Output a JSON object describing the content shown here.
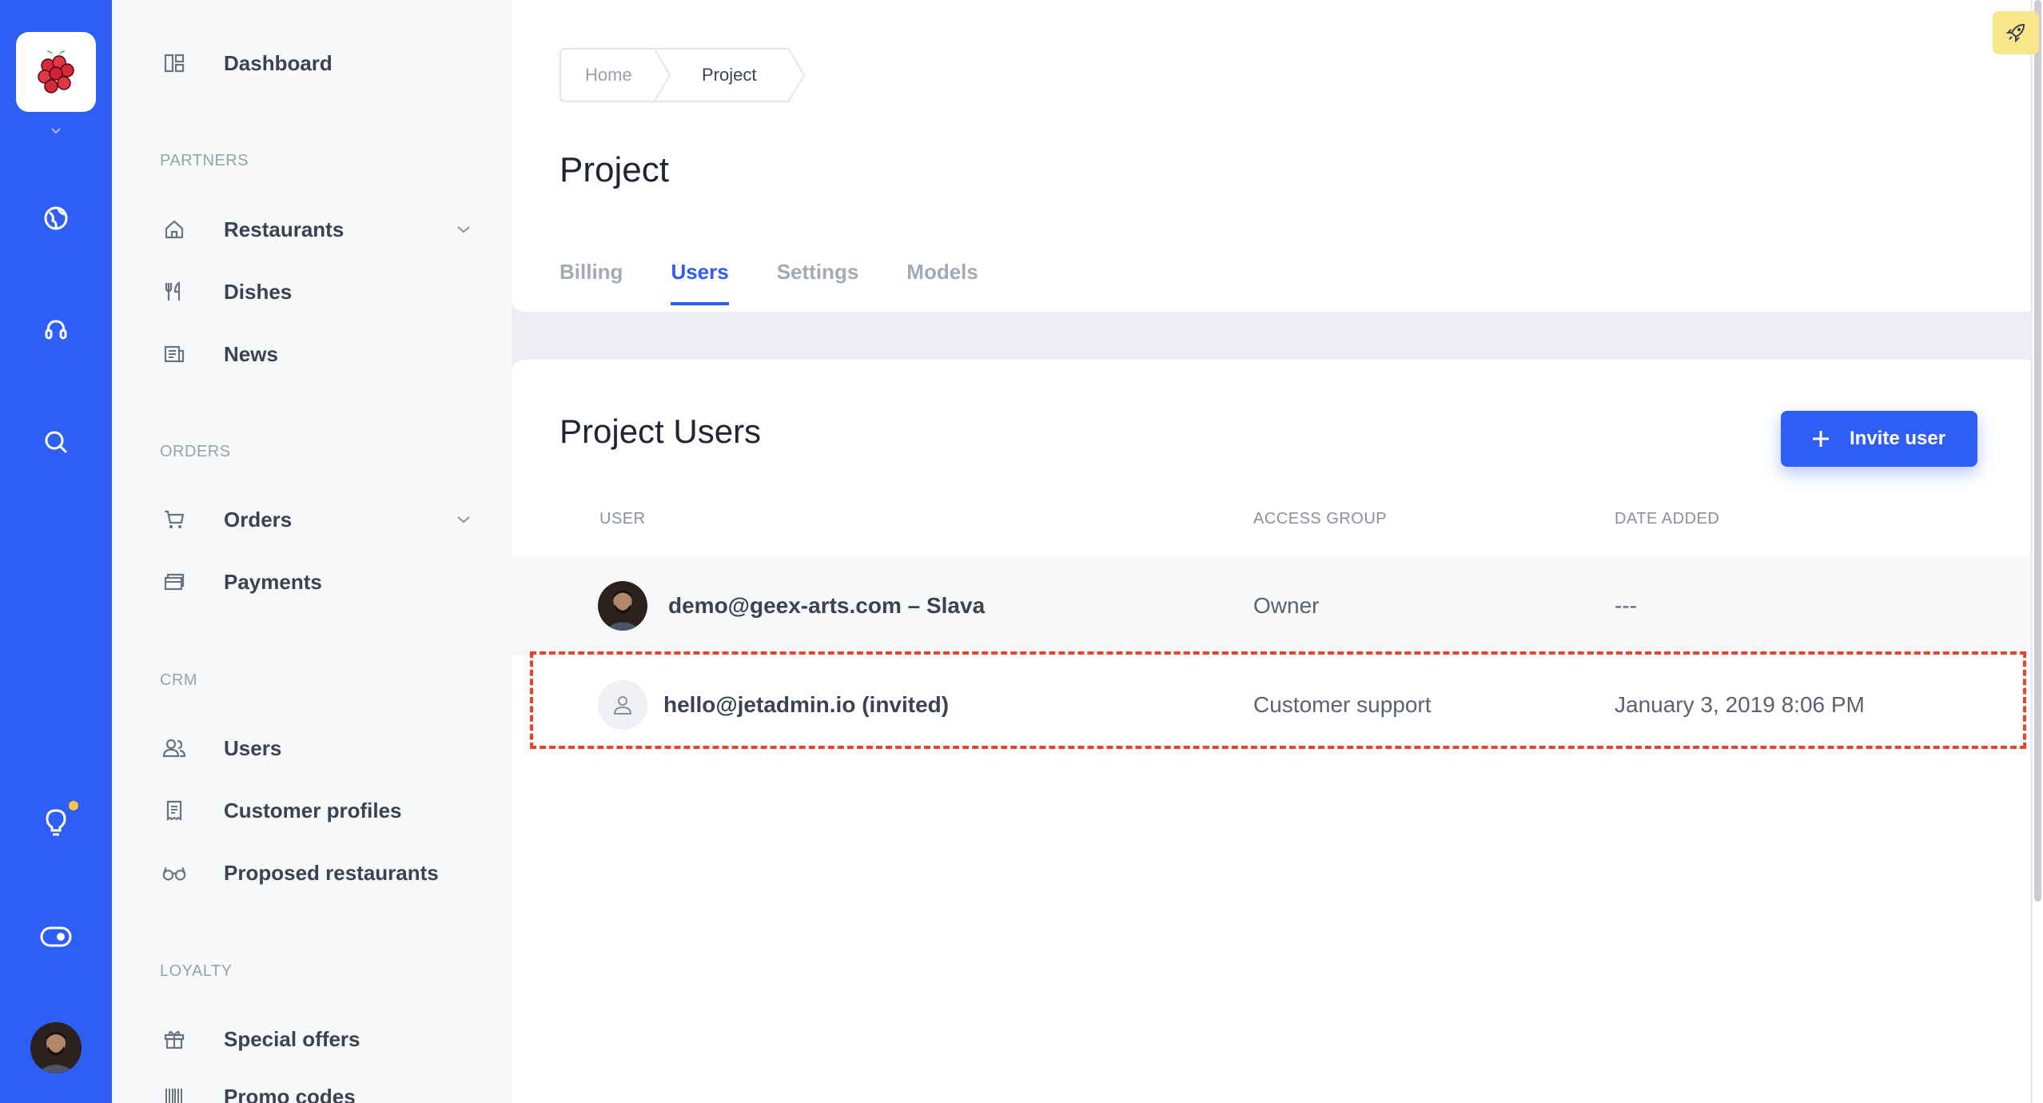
{
  "rail": {
    "icons": [
      "raspberry-logo-icon",
      "chevron-down-icon",
      "globe-icon",
      "support-icon",
      "search-icon",
      "lightbulb-icon",
      "toggle-icon",
      "avatar"
    ]
  },
  "sidebar": {
    "dashboard": "Dashboard",
    "sections": {
      "partners": "PARTNERS",
      "orders": "ORDERS",
      "crm": "CRM",
      "loyalty": "LOYALTY"
    },
    "items": {
      "restaurants": "Restaurants",
      "dishes": "Dishes",
      "news": "News",
      "orders": "Orders",
      "payments": "Payments",
      "users": "Users",
      "customer_profiles": "Customer profiles",
      "proposed_restaurants": "Proposed restaurants",
      "special_offers": "Special offers",
      "promo_codes": "Promo codes"
    }
  },
  "header": {
    "breadcrumb": [
      "Home",
      "Project"
    ],
    "title": "Project",
    "tabs": [
      "Billing",
      "Users",
      "Settings",
      "Models"
    ],
    "active_tab": "Users"
  },
  "main": {
    "title": "Project Users",
    "invite_label": "Invite user",
    "columns": [
      "USER",
      "ACCESS GROUP",
      "DATE ADDED"
    ],
    "rows": [
      {
        "user": "demo@geex-arts.com – Slava",
        "group": "Owner",
        "date": "---"
      },
      {
        "user": "hello@jetadmin.io (invited)",
        "group": "Customer support",
        "date": "January 3, 2019 8:06 PM"
      }
    ]
  },
  "colors": {
    "accent": "#2f5ef5",
    "highlight": "#e8432e",
    "notification": "#f6c744"
  }
}
